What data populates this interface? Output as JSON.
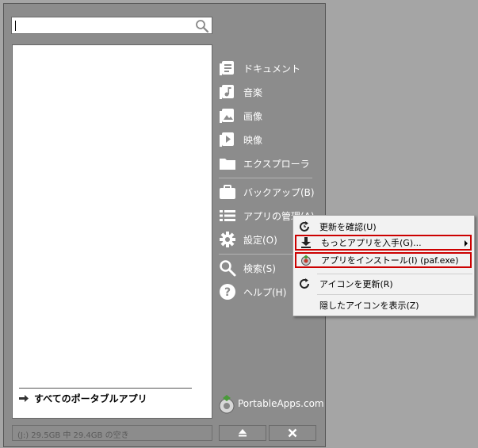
{
  "search": {
    "value": "",
    "placeholder": "",
    "icon": "search-icon"
  },
  "app_list": {
    "all_apps_label": "すべてのポータブルアプリ"
  },
  "nav": [
    {
      "label": "ドキュメント",
      "icon": "documents-icon"
    },
    {
      "label": "音楽",
      "icon": "music-icon"
    },
    {
      "label": "画像",
      "icon": "pictures-icon"
    },
    {
      "label": "映像",
      "icon": "video-icon"
    },
    {
      "label": "エクスプローラ",
      "icon": "folder-icon"
    },
    {
      "label": "バックアップ(B)",
      "icon": "briefcase-icon"
    },
    {
      "label": "アプリの管理(A)",
      "icon": "list-icon"
    },
    {
      "label": "設定(O)",
      "icon": "gear-icon"
    },
    {
      "label": "検索(S)",
      "icon": "search-icon"
    },
    {
      "label": "ヘルプ(H)",
      "icon": "help-icon"
    }
  ],
  "brand": {
    "name": "PortableApps.com"
  },
  "status": {
    "text": "(J:) 29.5GB 中 29.4GB の空き"
  },
  "context_menu": {
    "items": [
      {
        "label": "更新を確認(U)",
        "icon": "refresh-check-icon"
      },
      {
        "label": "もっとアプリを入手(G)...",
        "icon": "download-icon",
        "highlighted": true,
        "submenu": true
      },
      {
        "label": "アプリをインストール(I) (paf.exe)",
        "icon": "installer-icon",
        "highlighted": true
      },
      {
        "label": "アイコンを更新(R)",
        "icon": "refresh-icon"
      },
      {
        "label": "隠したアイコンを表示(Z)",
        "icon": ""
      }
    ],
    "highlight_color": "#cc0000"
  },
  "colors": {
    "panel_bg": "#8c8c8c",
    "window_bg": "#a5a5a5",
    "menu_bg": "#f2f2f2"
  }
}
